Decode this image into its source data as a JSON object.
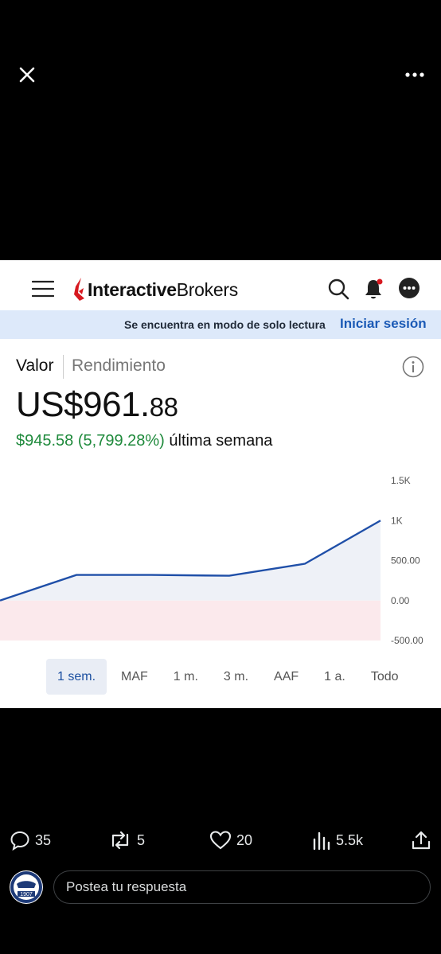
{
  "header": {
    "logo_bold": "Interactive",
    "logo_regular": "Brokers"
  },
  "banner": {
    "text": "Se encuentra en modo de solo lectura",
    "login": "Iniciar sesión"
  },
  "tabs": {
    "value": "Valor",
    "performance": "Rendimiento"
  },
  "price": {
    "main": "US$961.",
    "cents": "88"
  },
  "change": {
    "value": "$945.58 (5,799.28%)",
    "period": "última semana"
  },
  "ranges": [
    "1 sem.",
    "MAF",
    "1 m.",
    "3 m.",
    "AAF",
    "1 a.",
    "Todo"
  ],
  "active_range": "1 sem.",
  "chart_data": {
    "type": "line",
    "x": [
      0,
      1,
      2,
      3,
      4,
      5
    ],
    "values": [
      0,
      320,
      320,
      310,
      460,
      1000
    ],
    "ylim": [
      -500,
      1500
    ],
    "y_ticks": [
      "1.5K",
      "1K",
      "500.00",
      "0.00",
      "-500.00"
    ],
    "line_color": "#1f4fa8",
    "area_color_positive": "#eef1f7",
    "area_color_negative": "#fbe9ec"
  },
  "actions": {
    "replies": "35",
    "reposts": "5",
    "likes": "20",
    "views": "5.5k"
  },
  "reply": {
    "placeholder": "Postea tu respuesta"
  },
  "avatar": {
    "year": "1907"
  }
}
